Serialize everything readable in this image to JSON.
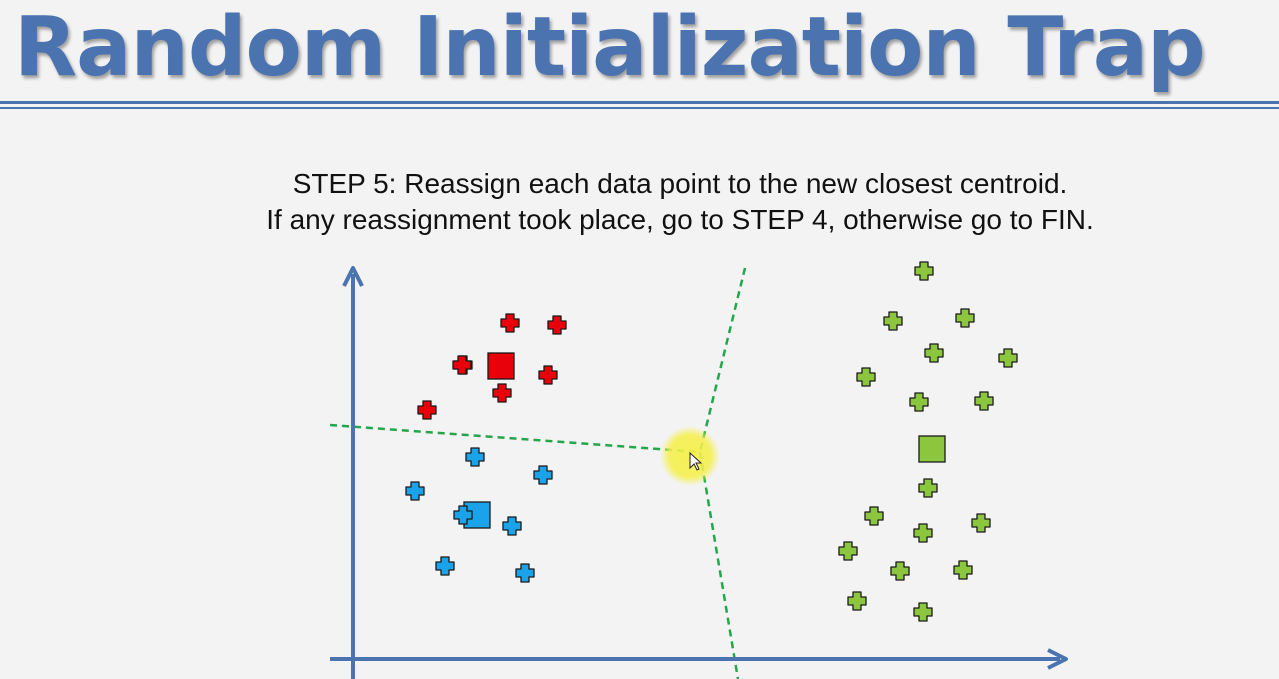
{
  "slide": {
    "title": "Random Initialization Trap",
    "step_line_1": "STEP 5: Reassign each data point to the new closest centroid.",
    "step_line_2": "If any reassignment took place, go to STEP 4, otherwise go to FIN."
  },
  "colors": {
    "title": "#4a73b0",
    "axes": "#4a73b0",
    "red_cluster": "#e8000b",
    "blue_cluster": "#1aa3e8",
    "green_cluster": "#8cc63f",
    "boundary": "#22a84a",
    "highlight": "#f2ee4a"
  },
  "clusters": [
    {
      "name": "red",
      "centroid_count": 1,
      "point_count": 7
    },
    {
      "name": "blue",
      "centroid_count": 1,
      "point_count": 7
    },
    {
      "name": "green",
      "centroid_count": 1,
      "point_count": 18
    }
  ],
  "decision_boundary": {
    "style": "dashed",
    "segments": 3
  }
}
